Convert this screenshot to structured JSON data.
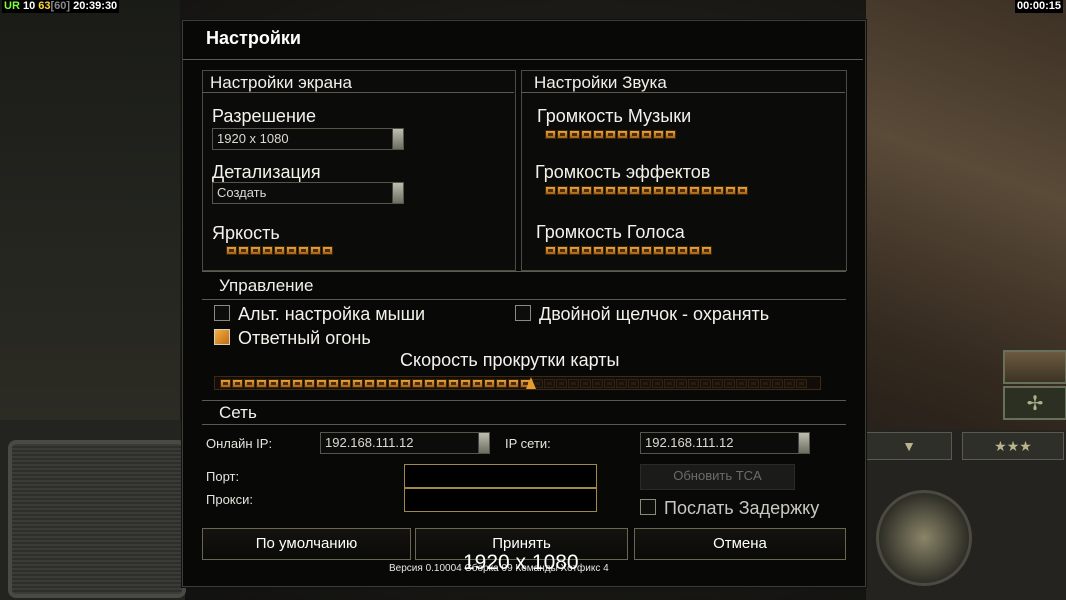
{
  "hud": {
    "ur_label": "UR",
    "stat1": "10",
    "fps": "63",
    "fps_cap": "[60]",
    "clock": "20:39:30",
    "timer": "00:00:15",
    "arrow_btn": "▼",
    "stars_btn": "★★★"
  },
  "dialog": {
    "title": "Настройки",
    "screen": {
      "title": "Настройки экрана",
      "resolution_label": "Разрешение",
      "resolution_value": "1920 x 1080",
      "detail_label": "Детализация",
      "detail_value": "Создать",
      "brightness_label": "Яркость",
      "brightness_level": 9
    },
    "sound": {
      "title": "Настройки Звука",
      "music_label": "Громкость Музыки",
      "music_level": 11,
      "effects_label": "Громкость эффектов",
      "effects_level": 17,
      "voice_label": "Громкость Голоса",
      "voice_level": 14
    },
    "controls": {
      "title": "Управление",
      "alt_mouse_label": "Альт. настройка мыши",
      "alt_mouse_checked": false,
      "double_click_label": "Двойной щелчок - охранять",
      "double_click_checked": false,
      "return_fire_label": "Ответный огонь",
      "return_fire_checked": true,
      "scroll_speed_label": "Скорость прокрутки карты",
      "scroll_speed_filled": 26,
      "scroll_speed_total": 49
    },
    "network": {
      "title": "Сеть",
      "online_ip_label": "Онлайн IP:",
      "online_ip_value": "192.168.111.12",
      "lan_ip_label": "IP сети:",
      "lan_ip_value": "192.168.111.12",
      "port_label": "Порт:",
      "port_value": "",
      "proxy_label": "Прокси:",
      "proxy_value": "",
      "update_tca_label": "Обновить TCA",
      "send_delay_label": "Послать Задержку",
      "send_delay_checked": false
    },
    "buttons": {
      "defaults": "По умолчанию",
      "accept": "Принять",
      "cancel": "Отмена"
    },
    "version_text": "Версия 0.10004 Сборка 09 Команды Хотфикс 4",
    "resolution_overlay": "1920 x 1080"
  },
  "colors": {
    "slider_on": "#e7a33a",
    "slider_off": "#1a120a",
    "checkbox_on": "#f0b040",
    "accent_border": "#a08a4a"
  }
}
